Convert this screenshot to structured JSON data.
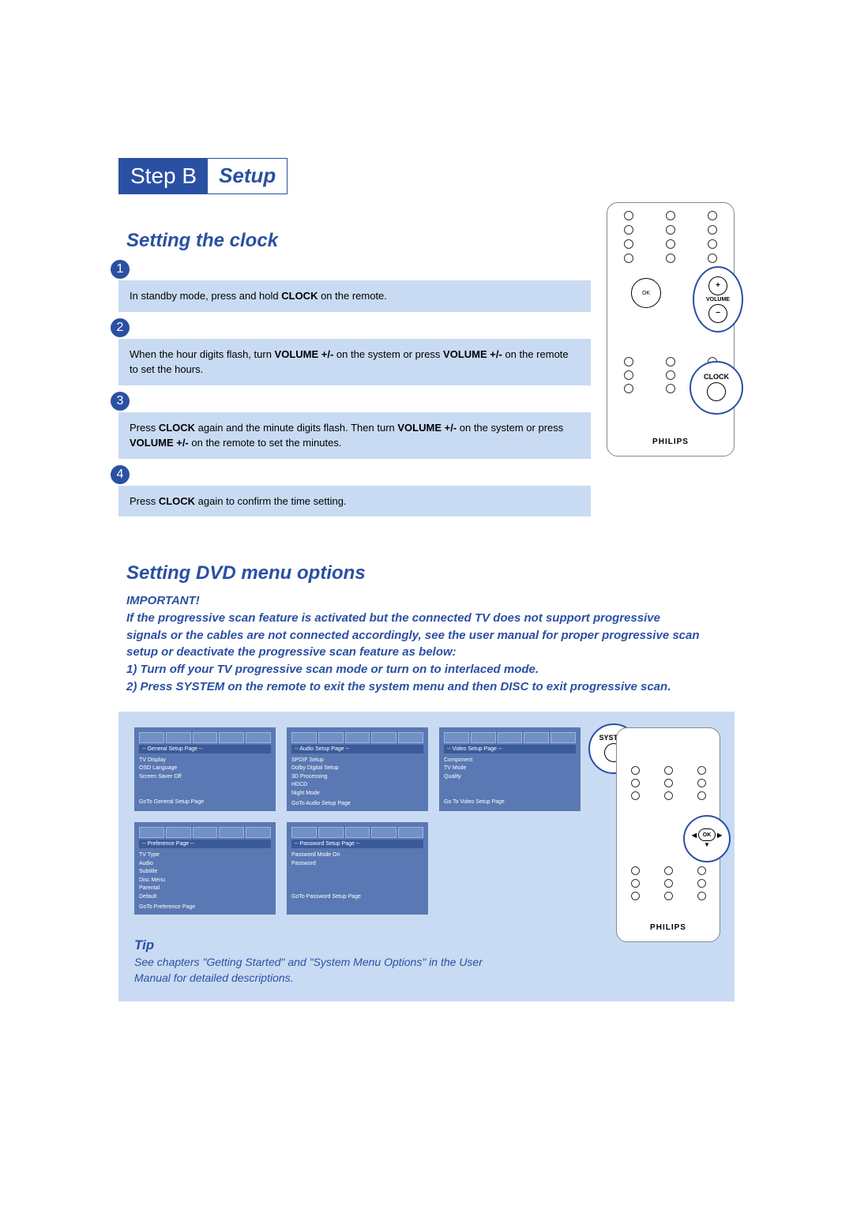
{
  "header": {
    "step_label": "Step B",
    "step_sub": "Setup"
  },
  "clock_section": {
    "title": "Setting the clock",
    "steps": [
      {
        "num": "1",
        "html": "In standby mode, press and hold <b>CLOCK</b> on the remote."
      },
      {
        "num": "2",
        "html": "When the hour digits flash, turn <b>VOLUME +/-</b> on the system or press <b>VOLUME +/-</b> on the remote to set the hours."
      },
      {
        "num": "3",
        "html": "Press <b>CLOCK</b> again and the minute digits flash. Then turn <b>VOLUME +/-</b> on the system or press <b>VOLUME +/-</b> on the remote to set the minutes."
      },
      {
        "num": "4",
        "html": "Press <b>CLOCK</b> again to confirm the time setting."
      }
    ]
  },
  "remote1": {
    "brand": "PHILIPS",
    "ok_label": "OK",
    "volume_label": "VOLUME",
    "clock_label": "CLOCK"
  },
  "dvd_section": {
    "title": "Setting DVD menu options",
    "important_label": "IMPORTANT!",
    "important_text": "If the progressive scan feature is activated but the connected TV does not support progressive signals or the cables are not connected accordingly, see the user manual for proper progressive scan setup or deactivate the progressive scan feature as below:\n1) Turn off your TV progressive scan mode or turn on to interlaced mode.\n2) Press SYSTEM on the remote to exit the system menu and then DISC to exit progressive scan."
  },
  "menu_cards": [
    {
      "header": "-- General Setup Page --",
      "items": [
        "TV Display",
        "OSD Language",
        "Screen Saver    Off"
      ],
      "footer": "GoTo General Setup Page"
    },
    {
      "header": "-- Audio Setup Page --",
      "items": [
        "SPDIF Setup",
        "Dolby Digital Setup",
        "3D Processing",
        "HDCD",
        "Night Mode"
      ],
      "footer": "GoTo Audio Setup Page"
    },
    {
      "header": "-- Video Setup Page --",
      "items": [
        "Component",
        "TV Mode",
        "Quality"
      ],
      "footer": "Go To Video Setup Page"
    },
    {
      "header": "-- Preference Page --",
      "items": [
        "TV Type",
        "Audio",
        "Subtitle",
        "Disc Menu",
        "Parental",
        "Default"
      ],
      "footer": "GoTo Preference Page"
    },
    {
      "header": "-- Password Setup Page --",
      "items": [
        "Password Mode    On",
        "Password"
      ],
      "footer": "GoTo Password Setup Page"
    }
  ],
  "remote2": {
    "system_label": "SYSTEM",
    "ok_label": "OK",
    "brand": "PHILIPS"
  },
  "tip": {
    "title": "Tip",
    "text": "See chapters \"Getting Started\" and \"System Menu Options\" in the User Manual for detailed descriptions."
  }
}
